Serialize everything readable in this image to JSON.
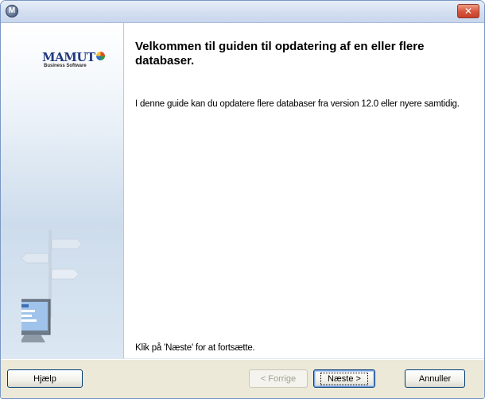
{
  "window": {
    "app_icon_glyph": "M",
    "close_glyph": "✕"
  },
  "sidebar": {
    "logo": {
      "word": "MAMUT",
      "tagline": "Business Software"
    }
  },
  "content": {
    "heading": "Velkommen til guiden til opdatering af en eller flere databaser.",
    "description": "I denne guide kan du opdatere flere databaser fra version 12.0 eller nyere samtidig.",
    "footer_note": "Klik på 'Næste' for at fortsætte."
  },
  "buttons": {
    "help": "Hjælp",
    "previous": "< Forrige",
    "next": "Næste >",
    "cancel": "Annuller"
  },
  "colors": {
    "title_bar": "#d3def0",
    "close_button": "#d5543b",
    "button_border": "#003c74"
  }
}
